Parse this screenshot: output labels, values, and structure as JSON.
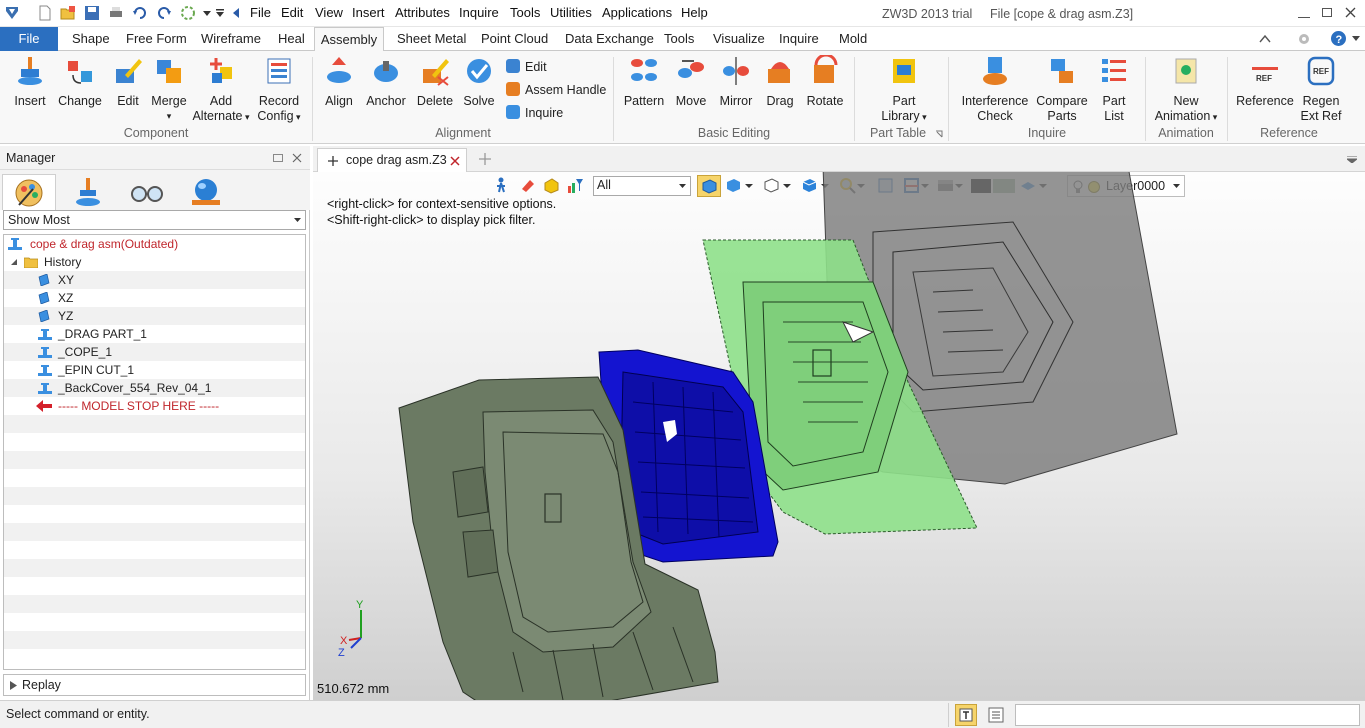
{
  "app": {
    "title": "ZW3D 2013 trial",
    "file_label": "File [cope & drag asm.Z3]"
  },
  "menu": [
    "File",
    "Edit",
    "View",
    "Insert",
    "Attributes",
    "Inquire",
    "Tools",
    "Utilities",
    "Applications",
    "Help"
  ],
  "ribbon_tabs": [
    "File",
    "Shape",
    "Free Form",
    "Wireframe",
    "Heal",
    "Assembly",
    "Sheet Metal",
    "Point Cloud",
    "Data Exchange",
    "Tools",
    "Visualize",
    "Inquire",
    "Mold"
  ],
  "active_tab": "Assembly",
  "ribbon": {
    "component": {
      "label": "Component",
      "buttons": [
        "Insert",
        "Change",
        "Edit",
        "Merge",
        "Add",
        "Alternate",
        "Record",
        "Config"
      ]
    },
    "alignment": {
      "label": "Alignment",
      "buttons": [
        "Align",
        "Anchor",
        "Delete",
        "Solve"
      ],
      "small": [
        "Edit",
        "Assem Handle",
        "Inquire"
      ]
    },
    "basic_editing": {
      "label": "Basic Editing",
      "buttons": [
        "Pattern",
        "Move",
        "Mirror",
        "Drag",
        "Rotate"
      ]
    },
    "part_table": {
      "label": "Part Table",
      "buttons": [
        "Part",
        "Library"
      ]
    },
    "inquire": {
      "label": "Inquire",
      "buttons": [
        "Interference",
        "Check",
        "Compare",
        "Parts",
        "Part",
        "List"
      ]
    },
    "animation": {
      "label": "Animation",
      "buttons": [
        "New",
        "Animation"
      ]
    },
    "reference": {
      "label": "Reference",
      "buttons": [
        "Reference",
        "Regen",
        "Ext Ref"
      ]
    }
  },
  "manager": {
    "title": "Manager",
    "filter": "Show Most",
    "tree": [
      {
        "label": "cope & drag asm(Outdated)",
        "kind": "root"
      },
      {
        "label": "History",
        "kind": "folder"
      },
      {
        "label": "XY",
        "kind": "plane"
      },
      {
        "label": "XZ",
        "kind": "plane"
      },
      {
        "label": "YZ",
        "kind": "plane"
      },
      {
        "label": "_DRAG PART_1",
        "kind": "part"
      },
      {
        "label": "_COPE_1",
        "kind": "part"
      },
      {
        "label": "_EPIN CUT_1",
        "kind": "part"
      },
      {
        "label": "_BackCover_554_Rev_04_1",
        "kind": "part"
      },
      {
        "label": "----- MODEL STOP HERE -----",
        "kind": "stop"
      }
    ],
    "replay": "Replay"
  },
  "viewport": {
    "doc_tab": "cope  drag asm.Z3",
    "filter_value": "All",
    "layer": "Layer0000",
    "hint1": "<right-click> for context-sensitive options.",
    "hint2": "<Shift-right-click> to display pick filter.",
    "units_readout": "510.672 mm",
    "axes": {
      "x": "X",
      "y": "Y",
      "z": "Z"
    }
  },
  "status": {
    "message": "Select command or entity."
  },
  "colors": {
    "file_tab": "#2b6fc0",
    "outdated_red": "#c0262c",
    "core_green": "#6b7a63",
    "cavity_blue": "#1414d0",
    "plate_green": "#8ee08a",
    "mold_grey": "#8a8a8a"
  }
}
